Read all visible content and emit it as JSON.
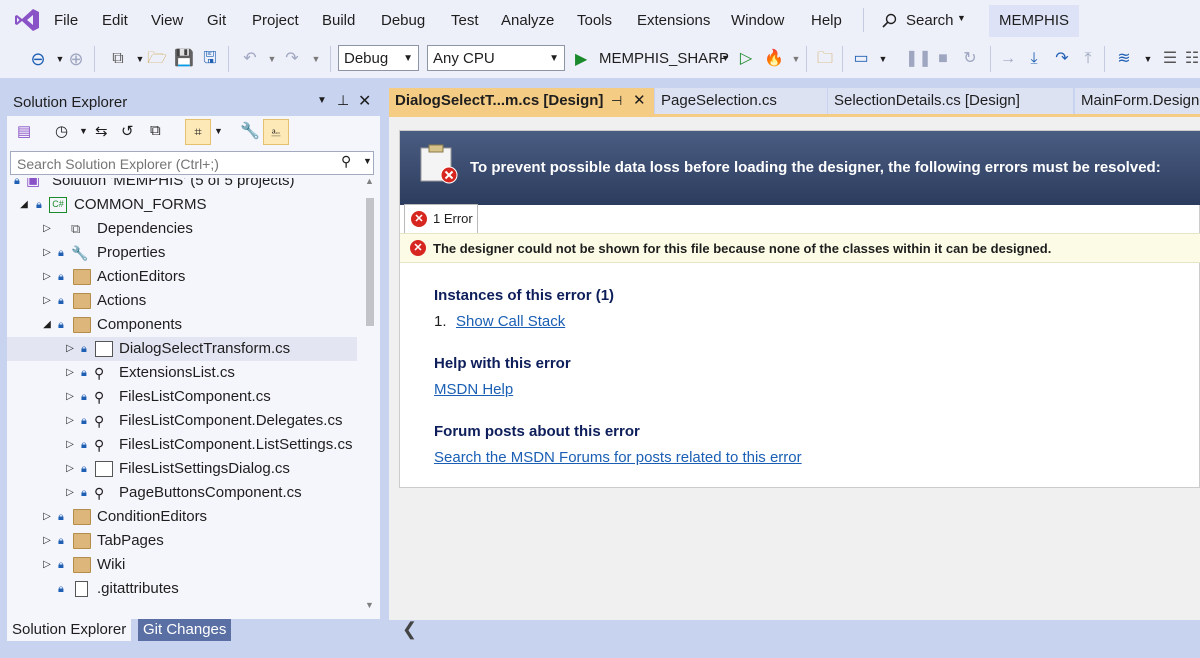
{
  "menu": [
    "File",
    "Edit",
    "View",
    "Git",
    "Project",
    "Build",
    "Debug",
    "Test",
    "Analyze",
    "Tools",
    "Extensions",
    "Window",
    "Help"
  ],
  "search_label": "Search",
  "solution_pill": "MEMPHIS",
  "toolbar": {
    "config": "Debug",
    "platform": "Any CPU",
    "run_target": "MEMPHIS_SHARP"
  },
  "solution_explorer": {
    "title": "Solution Explorer",
    "search_placeholder": "Search Solution Explorer (Ctrl+;)",
    "solution_label": "Solution 'MEMPHIS' (5 of 5 projects)",
    "project_label": "COMMON_FORMS",
    "items": [
      {
        "label": "Dependencies"
      },
      {
        "label": "Properties"
      },
      {
        "label": "ActionEditors"
      },
      {
        "label": "Actions"
      },
      {
        "label": "Components"
      },
      {
        "label": "DialogSelectTransform.cs"
      },
      {
        "label": "ExtensionsList.cs"
      },
      {
        "label": "FilesListComponent.cs"
      },
      {
        "label": "FilesListComponent.Delegates.cs"
      },
      {
        "label": "FilesListComponent.ListSettings.cs"
      },
      {
        "label": "FilesListSettingsDialog.cs"
      },
      {
        "label": "PageButtonsComponent.cs"
      },
      {
        "label": "ConditionEditors"
      },
      {
        "label": "TabPages"
      },
      {
        "label": "Wiki"
      },
      {
        "label": ".gitattributes"
      }
    ],
    "bottom_tabs": [
      "Solution Explorer",
      "Git Changes"
    ]
  },
  "doc_tabs": [
    {
      "label": "DialogSelectT...m.cs [Design]",
      "active": true
    },
    {
      "label": "PageSelection.cs"
    },
    {
      "label": "SelectionDetails.cs [Design]"
    },
    {
      "label": "MainForm.Designer.cs"
    }
  ],
  "error_page": {
    "banner": "To prevent possible data loss before loading the designer, the following errors must be resolved:",
    "tab_label": "1 Error",
    "message": "The designer could not be shown for this file because none of the classes within it can be designed.",
    "instances_heading": "Instances of this error (1)",
    "instance_number": "1.",
    "show_call_stack": "Show Call Stack",
    "help_heading": "Help with this error",
    "msdn_help": "MSDN Help",
    "forum_heading": "Forum posts about this error",
    "forum_link": "Search the MSDN Forums for posts related to this error"
  }
}
